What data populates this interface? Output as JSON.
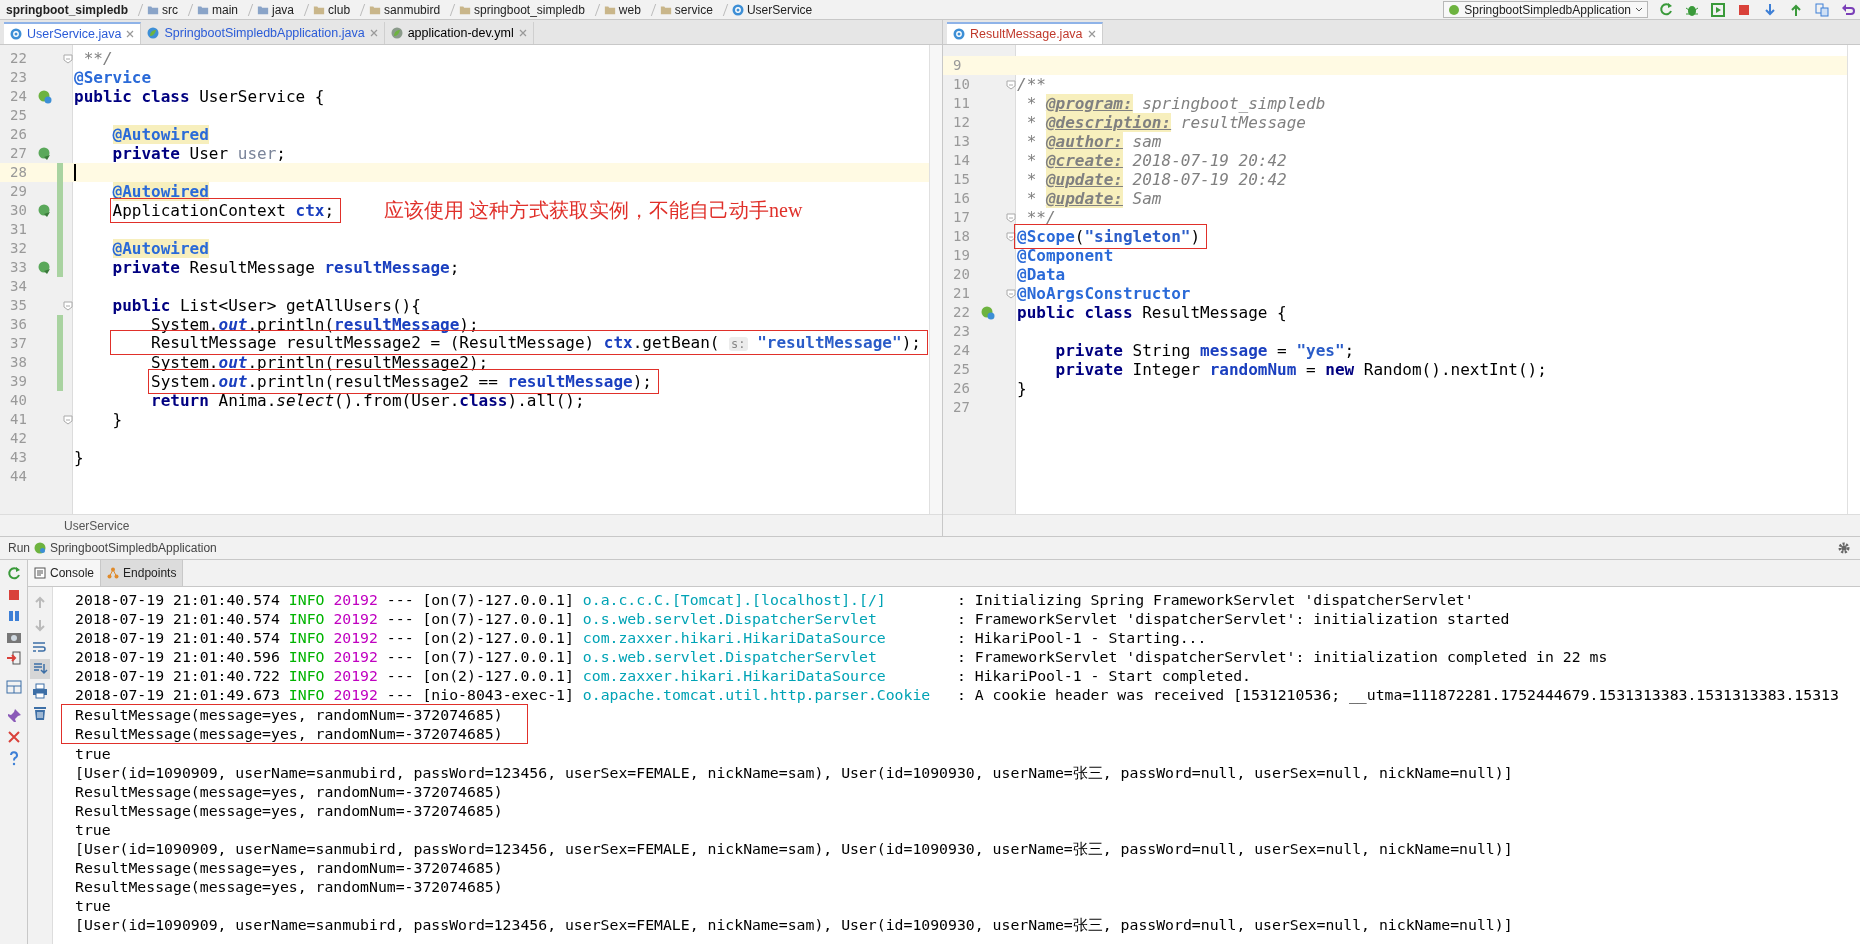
{
  "breadcrumb": [
    {
      "label": "springboot_simpledb",
      "kind": "project"
    },
    {
      "label": "src",
      "kind": "folder"
    },
    {
      "label": "main",
      "kind": "folder"
    },
    {
      "label": "java",
      "kind": "folder"
    },
    {
      "label": "club",
      "kind": "package"
    },
    {
      "label": "sanmubird",
      "kind": "package"
    },
    {
      "label": "springboot_simpledb",
      "kind": "package"
    },
    {
      "label": "web",
      "kind": "package"
    },
    {
      "label": "service",
      "kind": "package"
    },
    {
      "label": "UserService",
      "kind": "class"
    }
  ],
  "run_config": {
    "label": "SpringbootSimpledbApplication"
  },
  "left_editor": {
    "tabs": [
      {
        "label": "UserService.java",
        "kind": "class",
        "selected": true,
        "color": "#2a5bd7"
      },
      {
        "label": "SpringbootSimpledbApplication.java",
        "kind": "spring",
        "selected": false,
        "color": "#2a5bd7"
      },
      {
        "label": "application-dev.yml",
        "kind": "yml",
        "selected": false,
        "color": "#000000"
      }
    ],
    "lines": [
      {
        "no": "22",
        "kind": "top",
        "fold": true,
        "tokens": [
          {
            "kind": "comment",
            "text": " **/"
          }
        ]
      },
      {
        "no": "23",
        "kind": "top",
        "tokens": [
          {
            "kind": "annotation",
            "text": "@Service"
          }
        ]
      },
      {
        "no": "24",
        "kind": "top",
        "marker": {
          "kind": "bean-class"
        },
        "tokens": [
          {
            "kind": "keyword",
            "text": "public"
          },
          {
            "kind": "keyword",
            "text": " class"
          },
          {
            "kind": "plain",
            "text": " UserService {"
          }
        ]
      },
      {
        "no": "25"
      },
      {
        "no": "26",
        "kind": "member",
        "tokens": [
          {
            "kind": "annotation-hl",
            "text": "@Autowired"
          }
        ]
      },
      {
        "no": "27",
        "kind": "member",
        "marker": {
          "kind": "bean-link"
        },
        "tokens": [
          {
            "kind": "keyword",
            "text": "private"
          },
          {
            "kind": "plain",
            "text": " User "
          },
          {
            "kind": "field-unused",
            "text": "user"
          },
          {
            "kind": "plain",
            "text": ";"
          }
        ]
      },
      {
        "no": "28",
        "current": true,
        "caret": true,
        "changed": true
      },
      {
        "no": "29",
        "kind": "member",
        "changed": true,
        "tokens": [
          {
            "kind": "annotation-hl",
            "text": "@Autowired"
          }
        ]
      },
      {
        "no": "30",
        "kind": "member",
        "changed": true,
        "marker": {
          "kind": "bean-link"
        },
        "boxed": true,
        "note": "应该使用 这种方式获取实例，不能自己动手new",
        "tokens": [
          {
            "kind": "plain",
            "text": "ApplicationContext "
          },
          {
            "kind": "field",
            "text": "ctx"
          },
          {
            "kind": "plain",
            "text": ";"
          }
        ]
      },
      {
        "no": "31",
        "changed": true
      },
      {
        "no": "32",
        "kind": "member",
        "changed": true,
        "tokens": [
          {
            "kind": "annotation-hl",
            "text": "@Autowired"
          }
        ]
      },
      {
        "no": "33",
        "kind": "member",
        "changed": true,
        "marker": {
          "kind": "bean-link"
        },
        "tokens": [
          {
            "kind": "keyword",
            "text": "private"
          },
          {
            "kind": "plain",
            "text": " ResultMessage "
          },
          {
            "kind": "field",
            "text": "resultMessage"
          },
          {
            "kind": "plain",
            "text": ";"
          }
        ]
      },
      {
        "no": "34"
      },
      {
        "no": "35",
        "kind": "member",
        "fold": true,
        "tokens": [
          {
            "kind": "keyword",
            "text": "public"
          },
          {
            "kind": "plain",
            "text": " List<User> getAllUsers(){"
          }
        ]
      },
      {
        "no": "36",
        "kind": "body",
        "changed": true,
        "tokens": [
          {
            "kind": "plain",
            "text": "System."
          },
          {
            "kind": "static",
            "text": "out"
          },
          {
            "kind": "plain",
            "text": ".println("
          },
          {
            "kind": "field",
            "text": "resultMessage"
          },
          {
            "kind": "plain",
            "text": ");"
          }
        ]
      },
      {
        "no": "37",
        "kind": "member",
        "changed": true,
        "boxed": true,
        "tokens": [
          {
            "kind": "plain",
            "text": "    ResultMessage resultMessage2 = (ResultMessage) "
          },
          {
            "kind": "field",
            "text": "ctx"
          },
          {
            "kind": "plain",
            "text": ".getBean( "
          },
          {
            "kind": "hint",
            "text": "s:"
          },
          {
            "kind": "string",
            "text": " \"resultMessage\""
          },
          {
            "kind": "plain",
            "text": ");"
          }
        ]
      },
      {
        "no": "38",
        "kind": "body",
        "changed": true,
        "tokens": [
          {
            "kind": "plain",
            "text": "System."
          },
          {
            "kind": "static",
            "text": "out"
          },
          {
            "kind": "plain",
            "text": ".println(resultMessage2);"
          }
        ]
      },
      {
        "no": "39",
        "kind": "body",
        "changed": true,
        "boxed": true,
        "tokens": [
          {
            "kind": "plain",
            "text": "System."
          },
          {
            "kind": "static",
            "text": "out"
          },
          {
            "kind": "plain",
            "text": ".println(resultMessage2 == "
          },
          {
            "kind": "field",
            "text": "resultMessage"
          },
          {
            "kind": "plain",
            "text": ");"
          }
        ]
      },
      {
        "no": "40",
        "kind": "body",
        "tokens": [
          {
            "kind": "keyword",
            "text": "return"
          },
          {
            "kind": "plain",
            "text": " Anima."
          },
          {
            "kind": "italic",
            "text": "select"
          },
          {
            "kind": "plain",
            "text": "().from(User."
          },
          {
            "kind": "keyword",
            "text": "class"
          },
          {
            "kind": "plain",
            "text": ").all();"
          }
        ]
      },
      {
        "no": "41",
        "kind": "member",
        "fold": true,
        "tokens": [
          {
            "kind": "plain",
            "text": "}"
          }
        ]
      },
      {
        "no": "42"
      },
      {
        "no": "43",
        "kind": "top",
        "tokens": [
          {
            "kind": "plain",
            "text": "}"
          }
        ]
      },
      {
        "no": "44"
      }
    ],
    "footer": "UserService"
  },
  "right_editor": {
    "tabs": [
      {
        "label": "ResultMessage.java",
        "kind": "class",
        "selected": true,
        "color": "#c0392b"
      }
    ],
    "lines": [
      {
        "no": "9",
        "current": true
      },
      {
        "no": "10",
        "kind": "top",
        "fold": true,
        "tokens": [
          {
            "kind": "comment",
            "text": "/**"
          }
        ]
      },
      {
        "no": "11",
        "kind": "top",
        "tokens": [
          {
            "kind": "comment",
            "text": " * "
          },
          {
            "kind": "doctag",
            "text": "@program:"
          },
          {
            "kind": "comment",
            "text": " springboot_simpledb"
          }
        ]
      },
      {
        "no": "12",
        "kind": "top",
        "tokens": [
          {
            "kind": "comment",
            "text": " * "
          },
          {
            "kind": "doctag",
            "text": "@description:"
          },
          {
            "kind": "comment",
            "text": " resultMessage"
          }
        ]
      },
      {
        "no": "13",
        "kind": "top",
        "tokens": [
          {
            "kind": "comment",
            "text": " * "
          },
          {
            "kind": "doctag",
            "text": "@author:"
          },
          {
            "kind": "comment",
            "text": " sam"
          }
        ]
      },
      {
        "no": "14",
        "kind": "top",
        "tokens": [
          {
            "kind": "comment",
            "text": " * "
          },
          {
            "kind": "doctag",
            "text": "@create:"
          },
          {
            "kind": "comment",
            "text": " 2018-07-19 20:42"
          }
        ]
      },
      {
        "no": "15",
        "kind": "top",
        "tokens": [
          {
            "kind": "comment",
            "text": " * "
          },
          {
            "kind": "doctag",
            "text": "@update:"
          },
          {
            "kind": "comment",
            "text": " 2018-07-19 20:42"
          }
        ]
      },
      {
        "no": "16",
        "kind": "top",
        "tokens": [
          {
            "kind": "comment",
            "text": " * "
          },
          {
            "kind": "doctag",
            "text": "@update:"
          },
          {
            "kind": "comment",
            "text": " Sam"
          }
        ]
      },
      {
        "no": "17",
        "kind": "top",
        "fold": true,
        "tokens": [
          {
            "kind": "comment",
            "text": " **/"
          }
        ]
      },
      {
        "no": "18",
        "kind": "top",
        "fold": true,
        "boxed": true,
        "tokens": [
          {
            "kind": "annotation",
            "text": "@Scope"
          },
          {
            "kind": "plain",
            "text": "("
          },
          {
            "kind": "string",
            "text": "\"singleton\""
          },
          {
            "kind": "plain",
            "text": ")"
          }
        ]
      },
      {
        "no": "19",
        "kind": "top",
        "tokens": [
          {
            "kind": "annotation",
            "text": "@Component"
          }
        ]
      },
      {
        "no": "20",
        "kind": "top",
        "tokens": [
          {
            "kind": "annotation",
            "text": "@Data"
          }
        ]
      },
      {
        "no": "21",
        "kind": "top",
        "fold": true,
        "tokens": [
          {
            "kind": "annotation",
            "text": "@NoArgsConstructor"
          }
        ]
      },
      {
        "no": "22",
        "kind": "top",
        "marker": {
          "kind": "bean-class"
        },
        "tokens": [
          {
            "kind": "keyword",
            "text": "public"
          },
          {
            "kind": "keyword",
            "text": " class"
          },
          {
            "kind": "plain",
            "text": " ResultMessage {"
          }
        ]
      },
      {
        "no": "23"
      },
      {
        "no": "24",
        "kind": "member",
        "tokens": [
          {
            "kind": "keyword",
            "text": "private"
          },
          {
            "kind": "plain",
            "text": " String "
          },
          {
            "kind": "field",
            "text": "message"
          },
          {
            "kind": "plain",
            "text": " = "
          },
          {
            "kind": "string",
            "text": "\"yes\""
          },
          {
            "kind": "plain",
            "text": ";"
          }
        ]
      },
      {
        "no": "25",
        "kind": "member",
        "tokens": [
          {
            "kind": "keyword",
            "text": "private"
          },
          {
            "kind": "plain",
            "text": " Integer "
          },
          {
            "kind": "field",
            "text": "randomNum"
          },
          {
            "kind": "plain",
            "text": " = "
          },
          {
            "kind": "keyword",
            "text": "new"
          },
          {
            "kind": "plain",
            "text": " Random().nextInt();"
          }
        ]
      },
      {
        "no": "26",
        "kind": "top",
        "tokens": [
          {
            "kind": "plain",
            "text": "}"
          }
        ]
      },
      {
        "no": "27"
      }
    ]
  },
  "run_bar": {
    "label": "Run",
    "config": "SpringbootSimpledbApplication"
  },
  "console": {
    "tabs": [
      {
        "label": "Console",
        "kind": "console",
        "selected": true
      },
      {
        "label": "Endpoints",
        "kind": "endpoints",
        "selected": false
      }
    ],
    "lines": [
      {
        "kind": "log",
        "time": "2018-07-19 21:01:40.574",
        "level": "INFO",
        "pid": "20192",
        "sep": "---",
        "thread": "[on(7)-127.0.0.1]",
        "logger": "o.a.c.c.C.[Tomcat].[localhost].[/]",
        "message": ": Initializing Spring FrameworkServlet 'dispatcherServlet'"
      },
      {
        "kind": "log",
        "time": "2018-07-19 21:01:40.574",
        "level": "INFO",
        "pid": "20192",
        "sep": "---",
        "thread": "[on(7)-127.0.0.1]",
        "logger": "o.s.web.servlet.DispatcherServlet",
        "message": ": FrameworkServlet 'dispatcherServlet': initialization started"
      },
      {
        "kind": "log",
        "time": "2018-07-19 21:01:40.574",
        "level": "INFO",
        "pid": "20192",
        "sep": "---",
        "thread": "[on(2)-127.0.0.1]",
        "logger": "com.zaxxer.hikari.HikariDataSource",
        "message": ": HikariPool-1 - Starting..."
      },
      {
        "kind": "log",
        "time": "2018-07-19 21:01:40.596",
        "level": "INFO",
        "pid": "20192",
        "sep": "---",
        "thread": "[on(7)-127.0.0.1]",
        "logger": "o.s.web.servlet.DispatcherServlet",
        "message": ": FrameworkServlet 'dispatcherServlet': initialization completed in 22 ms"
      },
      {
        "kind": "log",
        "time": "2018-07-19 21:01:40.722",
        "level": "INFO",
        "pid": "20192",
        "sep": "---",
        "thread": "[on(2)-127.0.0.1]",
        "logger": "com.zaxxer.hikari.HikariDataSource",
        "message": ": HikariPool-1 - Start completed."
      },
      {
        "kind": "log",
        "time": "2018-07-19 21:01:49.673",
        "level": "INFO",
        "pid": "20192",
        "sep": "---",
        "thread": "[nio-8043-exec-1]",
        "logger": "o.apache.tomcat.util.http.parser.Cookie",
        "message": ": A cookie header was received [1531210536; __utma=111872281.1752444679.1531313383.1531313383.15313"
      },
      {
        "kind": "box",
        "lines": [
          {
            "text": "ResultMessage(message=yes, randomNum=-372074685)"
          },
          {
            "text": "ResultMessage(message=yes, randomNum=-372074685)"
          }
        ]
      },
      {
        "kind": "out",
        "text": "true"
      },
      {
        "kind": "out",
        "text": "[User(id=1090909, userName=sanmubird, passWord=123456, userSex=FEMALE, nickName=sam), User(id=1090930, userName=张三, passWord=null, userSex=null, nickName=null)]"
      },
      {
        "kind": "out",
        "text": "ResultMessage(message=yes, randomNum=-372074685)"
      },
      {
        "kind": "out",
        "text": "ResultMessage(message=yes, randomNum=-372074685)"
      },
      {
        "kind": "out",
        "text": "true"
      },
      {
        "kind": "out",
        "text": "[User(id=1090909, userName=sanmubird, passWord=123456, userSex=FEMALE, nickName=sam), User(id=1090930, userName=张三, passWord=null, userSex=null, nickName=null)]"
      },
      {
        "kind": "out",
        "text": "ResultMessage(message=yes, randomNum=-372074685)"
      },
      {
        "kind": "out",
        "text": "ResultMessage(message=yes, randomNum=-372074685)"
      },
      {
        "kind": "out",
        "text": "true"
      },
      {
        "kind": "out",
        "text": "[User(id=1090909, userName=sanmubird, passWord=123456, userSex=FEMALE, nickName=sam), User(id=1090930, userName=张三, passWord=null, userSex=null, nickName=null)]"
      }
    ]
  }
}
